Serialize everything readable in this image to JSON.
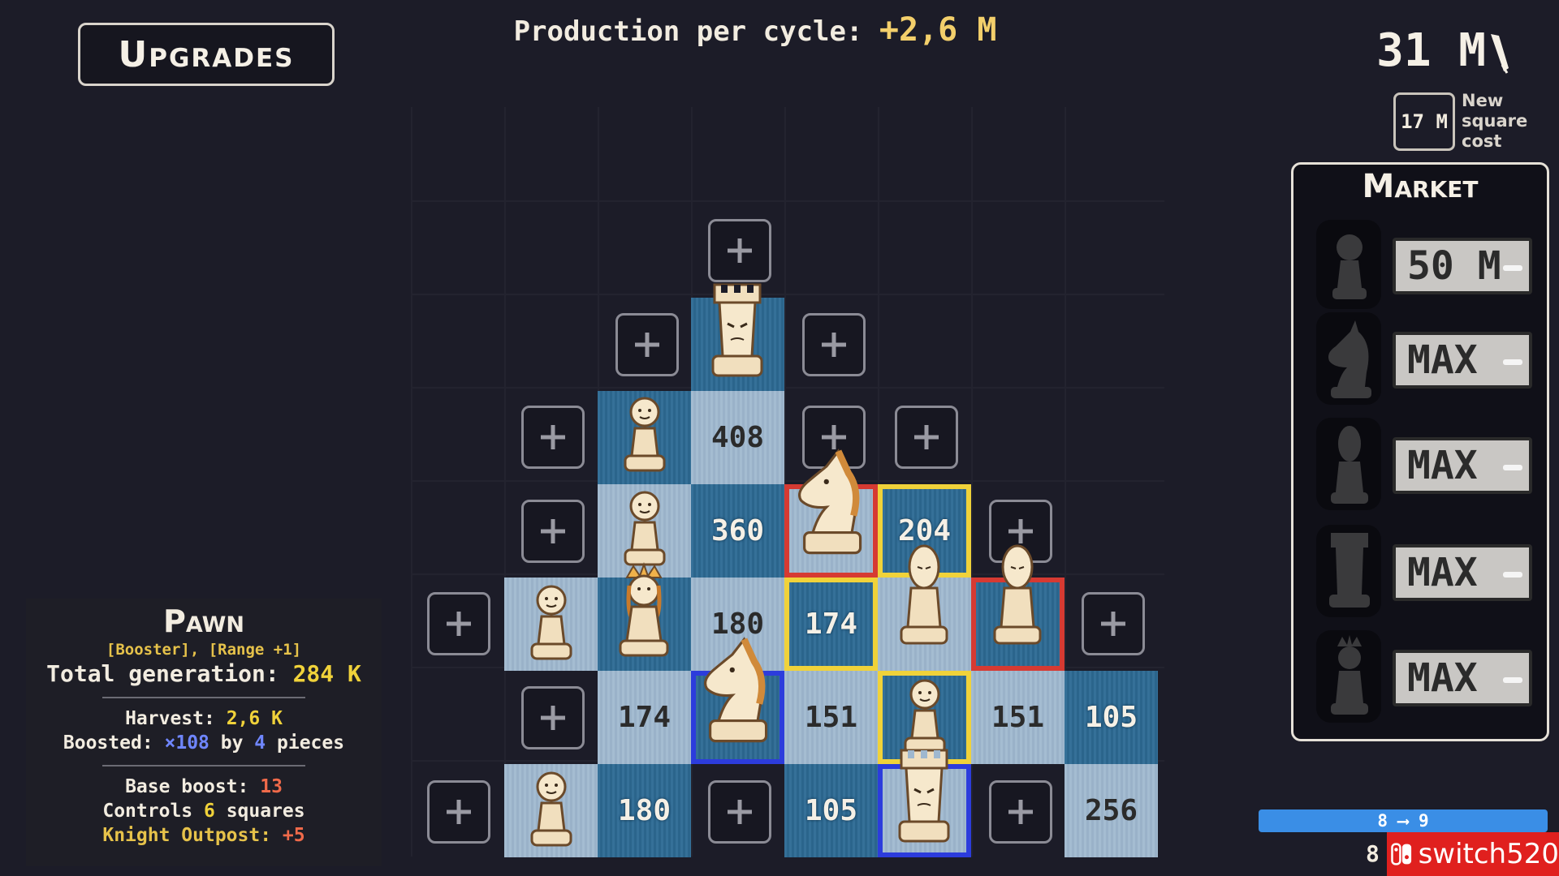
{
  "header": {
    "upgrades_label": "Upgrades",
    "production_label": "Production per cycle: ",
    "production_value": "+2,6 M",
    "money": "31 M",
    "new_square_cost": "17 M",
    "new_square_label": "New square cost"
  },
  "market": {
    "title": "Market",
    "items": [
      {
        "piece": "pawn",
        "price": "50 M"
      },
      {
        "piece": "knight",
        "price": "MAX"
      },
      {
        "piece": "bishop",
        "price": "MAX"
      },
      {
        "piece": "rook",
        "price": "MAX"
      },
      {
        "piece": "queen",
        "price": "MAX"
      }
    ]
  },
  "board": {
    "values": [
      "408",
      "360",
      "204",
      "180",
      "174",
      "174",
      "151",
      "151",
      "105",
      "180",
      "105",
      "256"
    ]
  },
  "info": {
    "title": "Pawn",
    "tags": "[Booster], [Range +1]",
    "total_label": "Total generation: ",
    "total_value": "284 K",
    "harvest_label": "Harvest: ",
    "harvest_value": "2,6 K",
    "boosted_label": "Boosted: ",
    "boosted_value": "×108",
    "boosted_by": " by ",
    "boosted_count": "4",
    "boosted_suffix": " pieces",
    "base_boost_label": "Base boost: ",
    "base_boost_value": "13",
    "controls_label": "Controls ",
    "controls_value": "6",
    "controls_suffix": " squares",
    "outpost_label": "Knight Outpost: ",
    "outpost_value": "+5"
  },
  "progress": {
    "label": "8 ⟶ 9",
    "level": "8"
  },
  "watermark": {
    "text": "switch520"
  },
  "colors": {
    "light_square": "#9fb8cf",
    "dark_square": "#2d6a94",
    "highlight_yellow": "#f0d23a",
    "highlight_red": "#d63a32",
    "highlight_blue": "#2c3cdc",
    "accent_gold": "#f3cf6b"
  }
}
